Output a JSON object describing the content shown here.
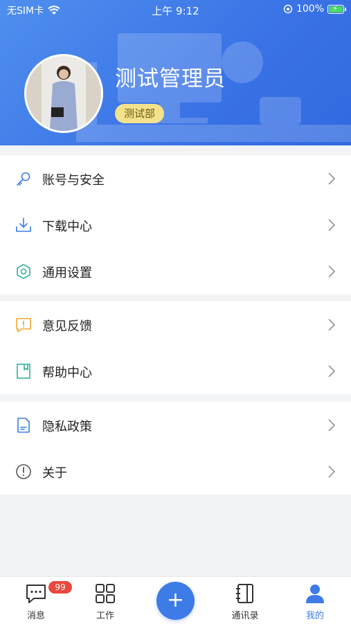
{
  "status_bar": {
    "carrier": "无SIM卡",
    "time": "上午 9:12",
    "battery": "100%"
  },
  "profile": {
    "name": "测试管理员",
    "department": "测试部"
  },
  "menu": {
    "group1": [
      {
        "label": "账号与安全",
        "icon": "key-icon",
        "color": "#3d7be6"
      },
      {
        "label": "下载中心",
        "icon": "download-icon",
        "color": "#3d7be6"
      },
      {
        "label": "通用设置",
        "icon": "hexagon-settings-icon",
        "color": "#2eb19b"
      }
    ],
    "group2": [
      {
        "label": "意见反馈",
        "icon": "feedback-icon",
        "color": "#f0a532"
      },
      {
        "label": "帮助中心",
        "icon": "help-book-icon",
        "color": "#2eb19b"
      }
    ],
    "group3": [
      {
        "label": "隐私政策",
        "icon": "document-icon",
        "color": "#3d7be6"
      },
      {
        "label": "关于",
        "icon": "info-icon",
        "color": "#666666"
      }
    ]
  },
  "tabbar": {
    "messages": {
      "label": "消息",
      "badge": "99"
    },
    "work": {
      "label": "工作"
    },
    "add": {
      "label": "+"
    },
    "contacts": {
      "label": "通讯录"
    },
    "me": {
      "label": "我的"
    }
  },
  "colors": {
    "accent": "#3d7be6",
    "badge": "#e8483d",
    "dept_badge": "#f3e28b"
  }
}
